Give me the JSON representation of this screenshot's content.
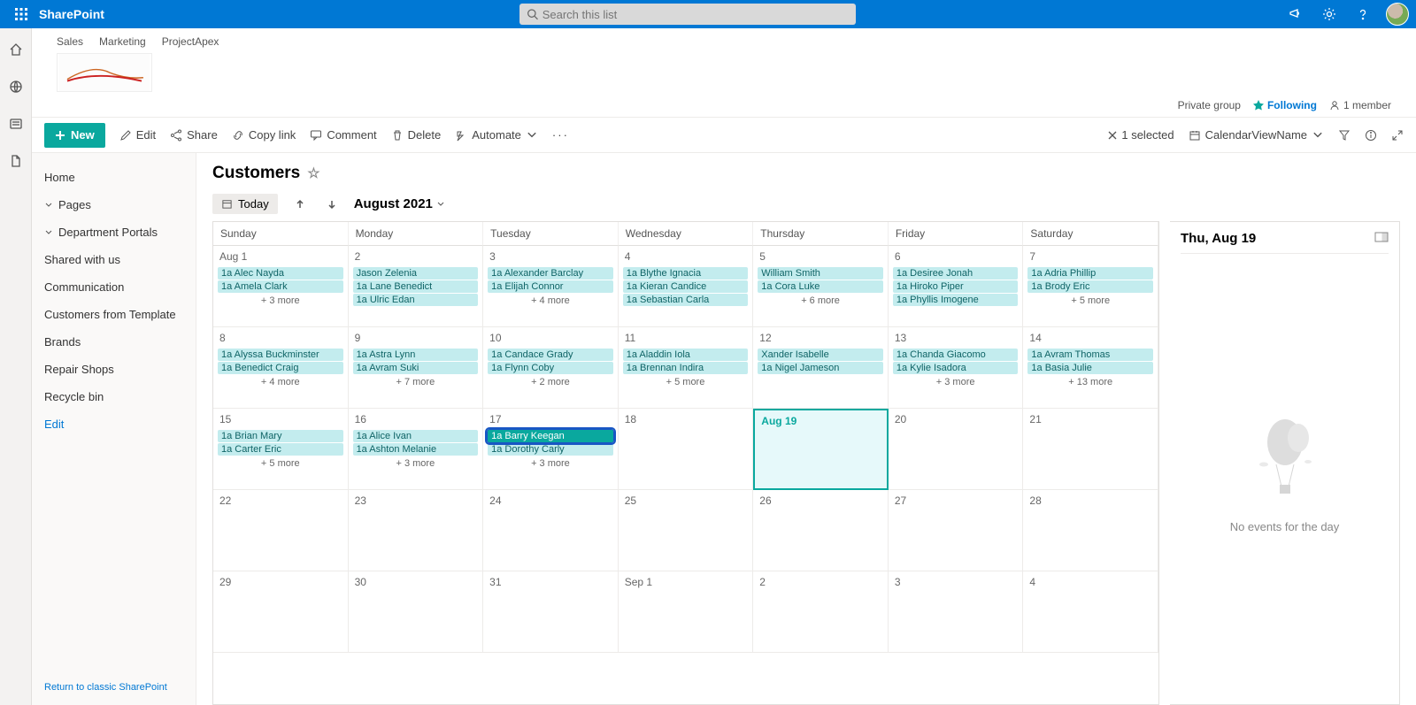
{
  "suite": {
    "app": "SharePoint",
    "search_placeholder": "Search this list"
  },
  "site": {
    "breadcrumbs": [
      "Sales",
      "Marketing",
      "ProjectApex"
    ],
    "group_type": "Private group",
    "following": "Following",
    "members": "1 member"
  },
  "cmd": {
    "new": "New",
    "edit": "Edit",
    "share": "Share",
    "copy": "Copy link",
    "comment": "Comment",
    "delete": "Delete",
    "automate": "Automate",
    "selected": "1 selected",
    "view": "CalendarViewName"
  },
  "nav": {
    "home": "Home",
    "pages": "Pages",
    "dept": "Department Portals",
    "shared": "Shared with us",
    "comm": "Communication",
    "cust_tmpl": "Customers from Template",
    "brands": "Brands",
    "repair": "Repair Shops",
    "recycle": "Recycle bin",
    "edit": "Edit",
    "footer": "Return to classic SharePoint"
  },
  "list": {
    "title": "Customers"
  },
  "cal": {
    "today": "Today",
    "month": "August 2021",
    "dow": [
      "Sunday",
      "Monday",
      "Tuesday",
      "Wednesday",
      "Thursday",
      "Friday",
      "Saturday"
    ],
    "weeks": [
      [
        {
          "d": "Aug 1",
          "e": [
            {
              "t": "1a Alec Nayda"
            },
            {
              "t": "1a Amela Clark"
            }
          ],
          "more": "+ 3 more"
        },
        {
          "d": "2",
          "e": [
            {
              "t": "Jason Zelenia",
              "np": true
            },
            {
              "t": "1a Lane Benedict"
            },
            {
              "t": "1a Ulric Edan"
            }
          ]
        },
        {
          "d": "3",
          "e": [
            {
              "t": "1a Alexander Barclay"
            },
            {
              "t": "1a Elijah Connor"
            }
          ],
          "more": "+ 4 more"
        },
        {
          "d": "4",
          "e": [
            {
              "t": "1a Blythe Ignacia"
            },
            {
              "t": "1a Kieran Candice"
            },
            {
              "t": "1a Sebastian Carla"
            }
          ]
        },
        {
          "d": "5",
          "e": [
            {
              "t": "William Smith",
              "np": true
            },
            {
              "t": "1a Cora Luke"
            }
          ],
          "more": "+ 6 more"
        },
        {
          "d": "6",
          "e": [
            {
              "t": "1a Desiree Jonah"
            },
            {
              "t": "1a Hiroko Piper"
            },
            {
              "t": "1a Phyllis Imogene"
            }
          ]
        },
        {
          "d": "7",
          "e": [
            {
              "t": "1a Adria Phillip"
            },
            {
              "t": "1a Brody Eric"
            }
          ],
          "more": "+ 5 more"
        }
      ],
      [
        {
          "d": "8",
          "e": [
            {
              "t": "1a Alyssa Buckminster"
            },
            {
              "t": "1a Benedict Craig"
            }
          ],
          "more": "+ 4 more"
        },
        {
          "d": "9",
          "e": [
            {
              "t": "1a Astra Lynn"
            },
            {
              "t": "1a Avram Suki"
            }
          ],
          "more": "+ 7 more"
        },
        {
          "d": "10",
          "e": [
            {
              "t": "1a Candace Grady"
            },
            {
              "t": "1a Flynn Coby"
            }
          ],
          "more": "+ 2 more"
        },
        {
          "d": "11",
          "e": [
            {
              "t": "1a Aladdin Iola"
            },
            {
              "t": "1a Brennan Indira"
            }
          ],
          "more": "+ 5 more"
        },
        {
          "d": "12",
          "e": [
            {
              "t": "Xander Isabelle",
              "np": true
            },
            {
              "t": "1a Nigel Jameson"
            }
          ]
        },
        {
          "d": "13",
          "e": [
            {
              "t": "1a Chanda Giacomo"
            },
            {
              "t": "1a Kylie Isadora"
            }
          ],
          "more": "+ 3 more"
        },
        {
          "d": "14",
          "e": [
            {
              "t": "1a Avram Thomas"
            },
            {
              "t": "1a Basia Julie"
            }
          ],
          "more": "+ 13 more"
        }
      ],
      [
        {
          "d": "15",
          "e": [
            {
              "t": "1a Brian Mary"
            },
            {
              "t": "1a Carter Eric"
            }
          ],
          "more": "+ 5 more"
        },
        {
          "d": "16",
          "e": [
            {
              "t": "1a Alice Ivan"
            },
            {
              "t": "1a Ashton Melanie"
            }
          ],
          "more": "+ 3 more"
        },
        {
          "d": "17",
          "e": [
            {
              "t": "1a Barry Keegan",
              "sel": true
            },
            {
              "t": "1a Dorothy Carly"
            }
          ],
          "more": "+ 3 more"
        },
        {
          "d": "18"
        },
        {
          "d": "Aug 19",
          "today": true
        },
        {
          "d": "20"
        },
        {
          "d": "21"
        }
      ],
      [
        {
          "d": "22"
        },
        {
          "d": "23"
        },
        {
          "d": "24"
        },
        {
          "d": "25"
        },
        {
          "d": "26"
        },
        {
          "d": "27"
        },
        {
          "d": "28"
        }
      ],
      [
        {
          "d": "29"
        },
        {
          "d": "30"
        },
        {
          "d": "31"
        },
        {
          "d": "Sep 1"
        },
        {
          "d": "2"
        },
        {
          "d": "3"
        },
        {
          "d": "4"
        }
      ]
    ]
  },
  "panel": {
    "title": "Thu, Aug 19",
    "empty": "No events for the day"
  }
}
